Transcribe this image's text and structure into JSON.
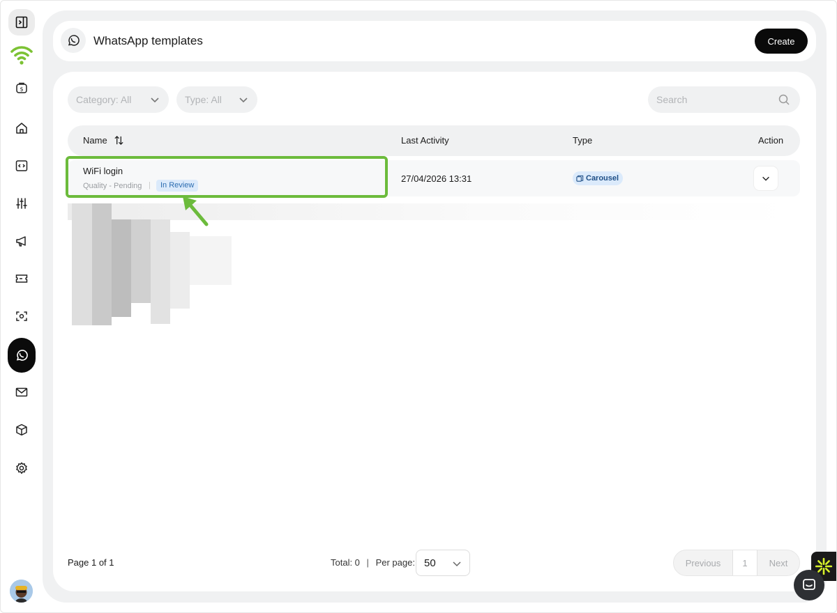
{
  "header": {
    "title": "WhatsApp templates",
    "create_label": "Create"
  },
  "filters": {
    "category": "Category: All",
    "type": "Type: All",
    "search_placeholder": "Search"
  },
  "table": {
    "columns": {
      "name": "Name",
      "last_activity": "Last Activity",
      "type": "Type",
      "action": "Action"
    },
    "rows": [
      {
        "name": "WiFi login",
        "quality": "Quality - Pending",
        "separator": "|",
        "status": "In Review",
        "last_activity": "27/04/2026 13:31",
        "type": "Carousel"
      }
    ]
  },
  "footer": {
    "page_info": "Page 1 of 1",
    "total": "Total: 0",
    "divider": "|",
    "per_page_label": "Per page:",
    "per_page_value": "50",
    "previous": "Previous",
    "page_number": "1",
    "next": "Next"
  },
  "colors": {
    "accent_green": "#6cbb3c",
    "badge_bg": "#dbeafb",
    "badge_text": "#2b6cb0",
    "logo_green": "#7cc234"
  },
  "sidebar_icons": [
    "sidebar-toggle-icon",
    "wifi-logo-icon",
    "billing-icon",
    "home-icon",
    "code-icon",
    "sliders-icon",
    "megaphone-icon",
    "ticket-icon",
    "scan-icon",
    "whatsapp-icon",
    "mail-icon",
    "cube-icon",
    "settings-icon"
  ]
}
